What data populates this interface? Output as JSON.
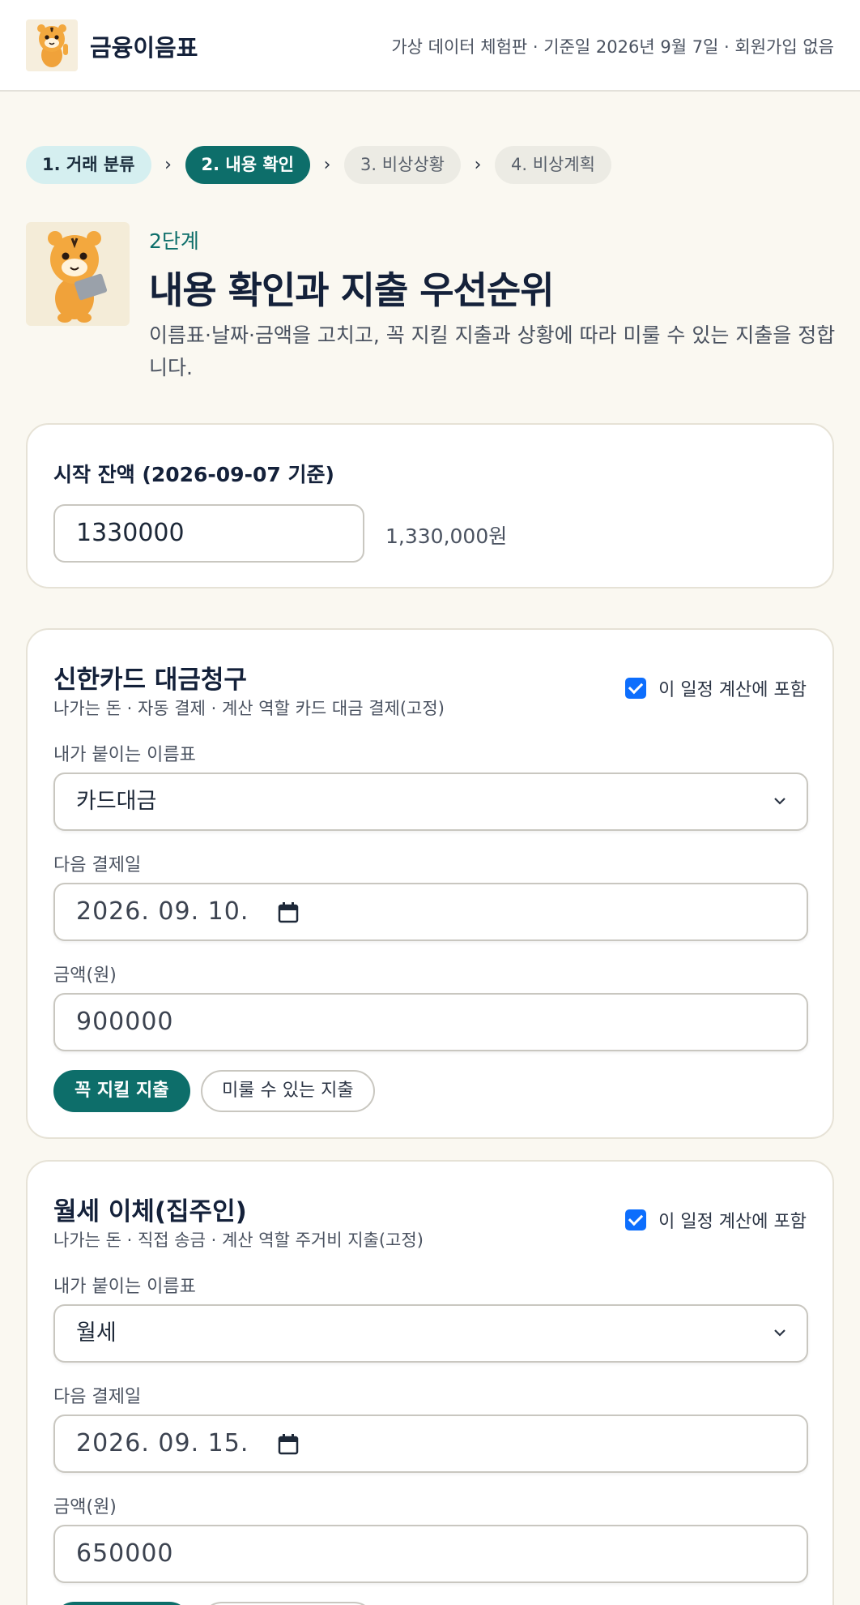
{
  "header": {
    "app_name": "금융이음표",
    "note": "가상 데이터 체험판 · 기준일 2026년 9월 7일 · 회원가입 없음"
  },
  "steps": [
    {
      "label": "1. 거래 분류",
      "state": "done"
    },
    {
      "label": "2. 내용 확인",
      "state": "active"
    },
    {
      "label": "3. 비상상황",
      "state": "todo"
    },
    {
      "label": "4. 비상계획",
      "state": "todo"
    }
  ],
  "step_separator": "›",
  "hero": {
    "step": "2단계",
    "title": "내용 확인과 지출 우선순위",
    "desc": "이름표·날짜·금액을 고치고, 꼭 지킬 지출과 상황에 따라 미룰 수 있는 지출을 정합니다."
  },
  "start_balance": {
    "label": "시작 잔액 (2026-09-07 기준)",
    "value": "1330000",
    "formatted": "1,330,000원"
  },
  "common": {
    "include_label": "이 일정 계산에 포함",
    "tag_label": "내가 붙이는 이름표",
    "date_label": "다음 결제일",
    "amount_label": "금액(원)",
    "must_label": "꼭 지킬 지출",
    "defer_label": "미룰 수 있는 지출"
  },
  "items": [
    {
      "title": "신한카드 대금청구",
      "sub": "나가는 돈 · 자동 결제 · 계산 역할 카드 대금 결제(고정)",
      "included": true,
      "tag": "카드대금",
      "date": "2026. 09. 10.",
      "amount": "900000",
      "priority": "must"
    },
    {
      "title": "월세 이체(집주인)",
      "sub": "나가는 돈 · 직접 송금 · 계산 역할 주거비 지출(고정)",
      "included": true,
      "tag": "월세",
      "date": "2026. 09. 15.",
      "amount": "650000",
      "priority": "must"
    }
  ],
  "colors": {
    "accent": "#0d6e6a",
    "checkbox": "#0d6efd",
    "background": "#faf8f1"
  }
}
